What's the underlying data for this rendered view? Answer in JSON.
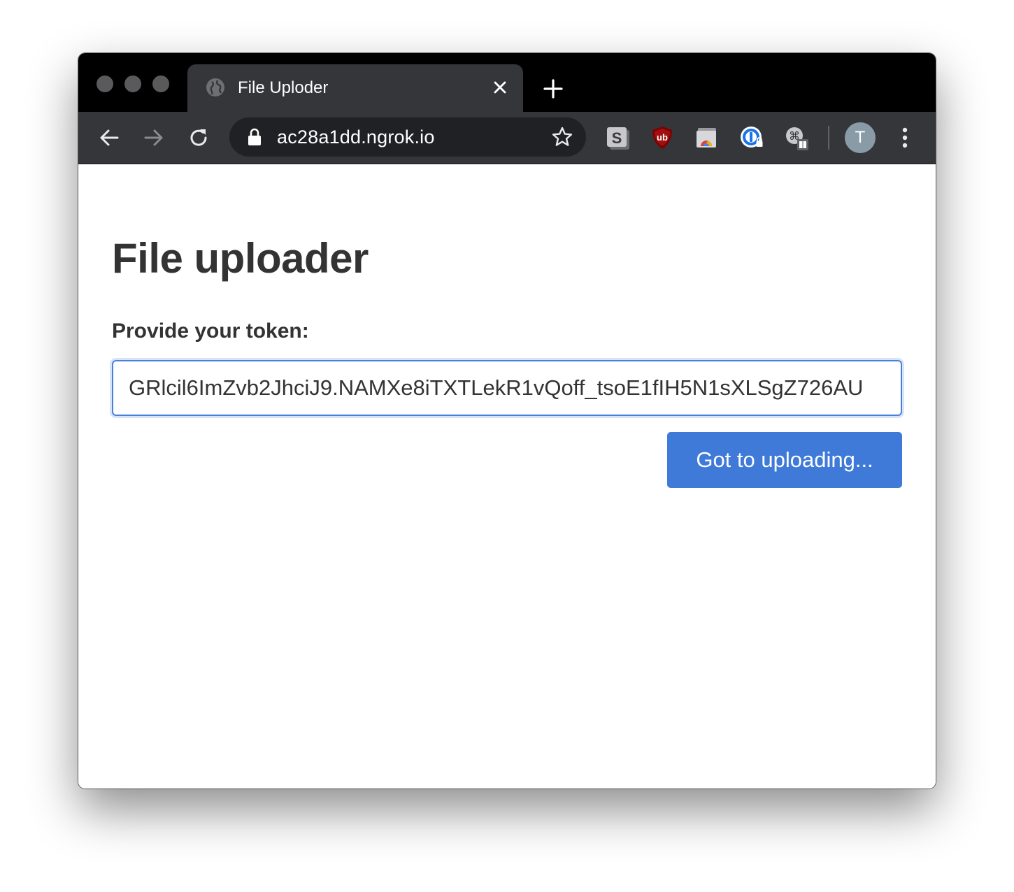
{
  "browser": {
    "tab": {
      "title": "File Uploder",
      "favicon": "globe-icon"
    },
    "omnibox": {
      "url": "ac28a1dd.ngrok.io"
    },
    "profile_initial": "T",
    "extensions": [
      "scribd-extension-icon",
      "ublock-origin-icon",
      "chrome-cast-extension-icon",
      "1password-icon",
      "shortcut-extension-icon"
    ]
  },
  "page": {
    "title": "File uploader",
    "token_label": "Provide your token:",
    "token_value": "GRlcil6ImZvb2JhciJ9.NAMXe8iTXTLekR1vQoff_tsoE1fIH5N1sXLSgZ726AU",
    "submit_label": "Got to uploading..."
  },
  "colors": {
    "accent": "#3f7ad8",
    "focus_border": "#4a80db",
    "text": "#333333",
    "chrome_dark": "#35363a"
  }
}
